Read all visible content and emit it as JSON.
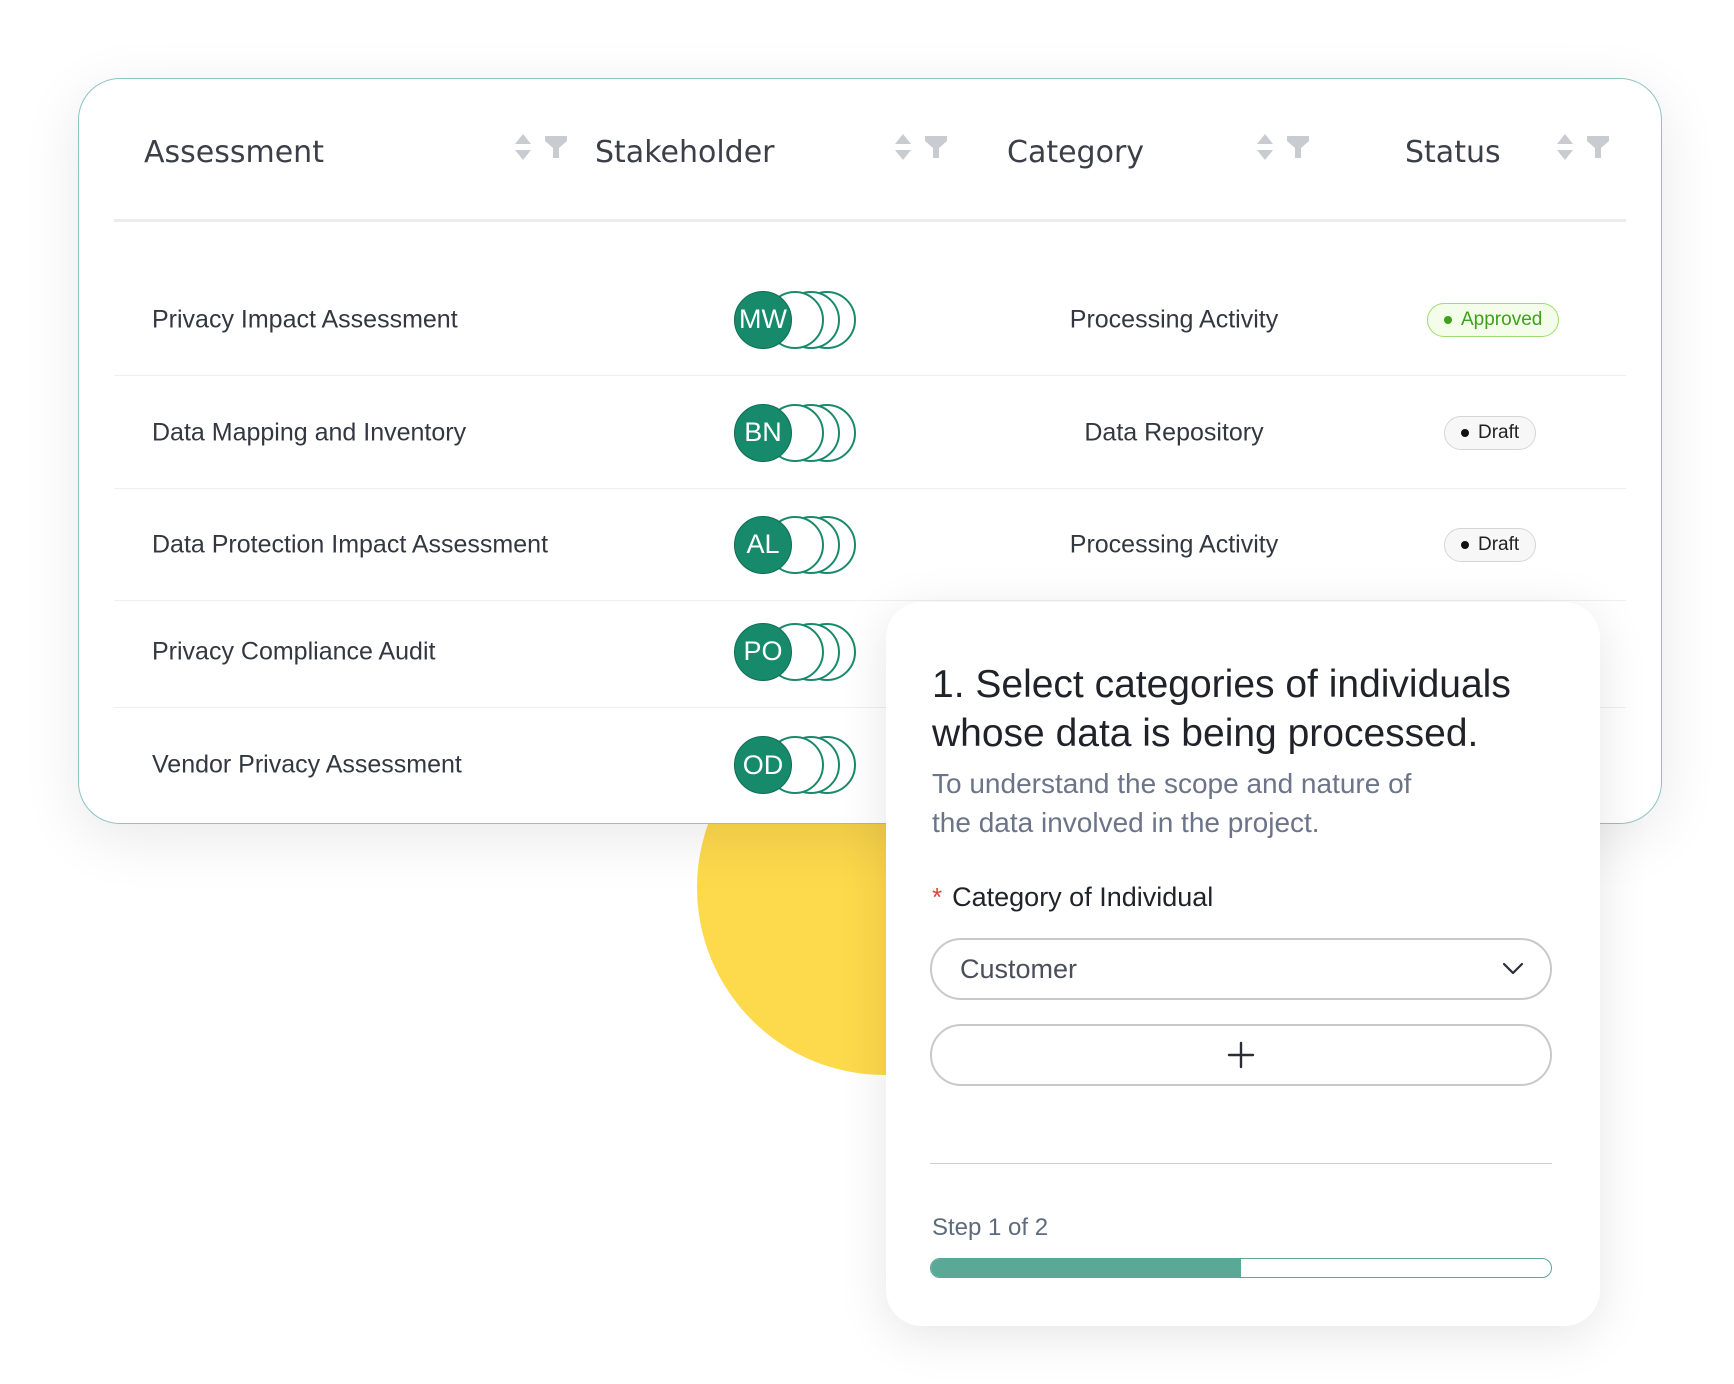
{
  "table": {
    "columns": [
      {
        "label": "Assessment"
      },
      {
        "label": "Stakeholder"
      },
      {
        "label": "Category"
      },
      {
        "label": "Status"
      }
    ],
    "rows": [
      {
        "assessment": "Privacy Impact Assessment",
        "initials": "MW",
        "category": "Processing Activity",
        "status": "Approved",
        "status_type": "approved"
      },
      {
        "assessment": "Data Mapping and Inventory",
        "initials": "BN",
        "category": "Data Repository",
        "status": "Draft",
        "status_type": "draft"
      },
      {
        "assessment": "Data Protection Impact Assessment",
        "initials": "AL",
        "category": "Processing Activity",
        "status": "Draft",
        "status_type": "draft"
      },
      {
        "assessment": "Privacy Compliance Audit",
        "initials": "PO",
        "category": "",
        "status": "",
        "status_type": ""
      },
      {
        "assessment": "Vendor Privacy Assessment",
        "initials": "OD",
        "category": "",
        "status": "",
        "status_type": ""
      }
    ]
  },
  "form": {
    "title": "1. Select categories of individuals whose data is being processed.",
    "subtitle": "To understand the scope and nature of the data involved in the project.",
    "field_label": "Category of Individual",
    "required_mark": "*",
    "select_value": "Customer",
    "add_icon": "plus-icon",
    "step_text": "Step 1 of 2",
    "progress_fraction": 0.5
  },
  "colors": {
    "accent": "#168a6b",
    "progress": "#5aa996",
    "highlight": "#fdd94c",
    "approved": "#3da11b",
    "required": "#e0413d"
  }
}
